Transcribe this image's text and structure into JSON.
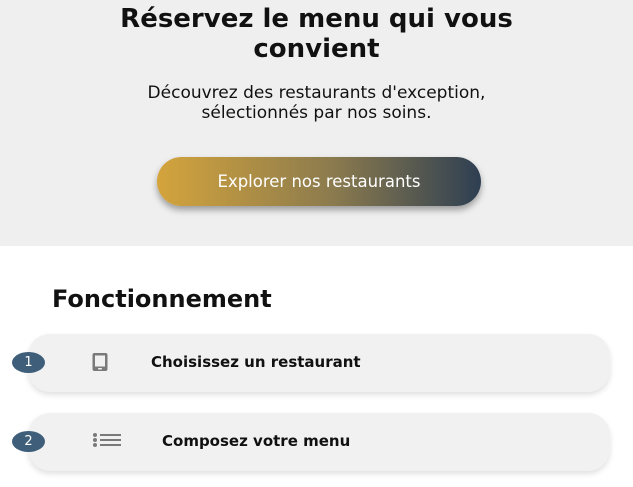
{
  "hero": {
    "title_line1": "Réservez le menu qui vous",
    "title_line2": "convient",
    "subtitle_line1": "Découvrez des restaurants d'exception,",
    "subtitle_line2": "sélectionnés par nos soins.",
    "cta_label": "Explorer nos restaurants"
  },
  "how_it_works": {
    "title": "Fonctionnement",
    "steps": [
      {
        "number": "1",
        "icon": "tablet-icon",
        "label": "Choisissez un restaurant"
      },
      {
        "number": "2",
        "icon": "list-icon",
        "label": "Composez votre menu"
      }
    ]
  },
  "colors": {
    "hero_background": "#efefef",
    "badge": "#3f5e7a",
    "cta_gradient_start": "#d4a43c",
    "cta_gradient_end": "#2e3f52"
  }
}
